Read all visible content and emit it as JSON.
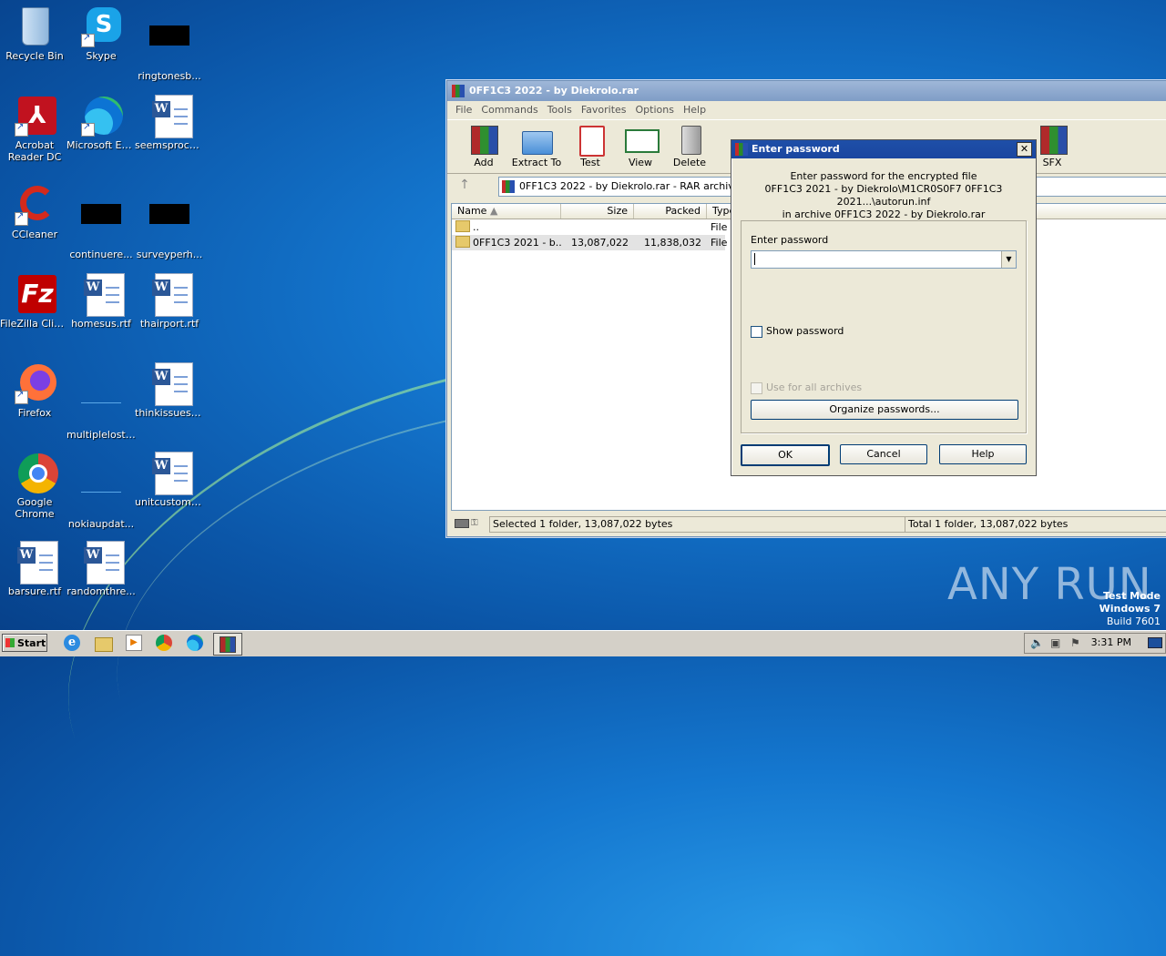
{
  "desktop": {
    "icons": [
      {
        "label": "Recycle Bin"
      },
      {
        "label": "Skype"
      },
      {
        "label": "ringtonesb..."
      },
      {
        "label": "Acrobat Reader DC"
      },
      {
        "label": "Microsoft Edge"
      },
      {
        "label": "seemsproce..."
      },
      {
        "label": "CCleaner"
      },
      {
        "label": "continuere..."
      },
      {
        "label": "surveyperh..."
      },
      {
        "label": "FileZilla Client"
      },
      {
        "label": "homesus.rtf"
      },
      {
        "label": "thairport.rtf"
      },
      {
        "label": "Firefox"
      },
      {
        "label": "multiplelost...."
      },
      {
        "label": "thinkissues.rtf"
      },
      {
        "label": "Google Chrome"
      },
      {
        "label": "nokiaupdat..."
      },
      {
        "label": "unitcustome..."
      },
      {
        "label": "barsure.rtf"
      },
      {
        "label": "randomthre..."
      }
    ]
  },
  "winrar": {
    "title": "0FF1C3 2022 - by Diekrolo.rar",
    "menu": [
      "File",
      "Commands",
      "Tools",
      "Favorites",
      "Options",
      "Help"
    ],
    "toolbar": [
      "Add",
      "Extract To",
      "Test",
      "View",
      "Delete",
      "SFX"
    ],
    "path": "0FF1C3 2022 - by Diekrolo.rar - RAR archive, ur",
    "columns": {
      "name": "Name",
      "size": "Size",
      "packed": "Packed",
      "type": "Type"
    },
    "rows": [
      {
        "name": "..",
        "size": "",
        "packed": "",
        "type": "File f"
      },
      {
        "name": "0FF1C3 2021 - b...",
        "size": "13,087,022",
        "packed": "11,838,032",
        "type": "File f"
      }
    ],
    "status_left": "Selected 1 folder, 13,087,022 bytes",
    "status_right": "Total 1 folder, 13,087,022 bytes"
  },
  "dialog": {
    "title": "Enter password",
    "info_line1": "Enter password for the encrypted file",
    "info_line2": "0FF1C3 2021 - by Diekrolo\\M1CR0S0F7 0FF1C3 2021...\\autorun.inf",
    "info_line3": "in archive 0FF1C3 2022 - by Diekrolo.rar",
    "field_label": "Enter password",
    "field_value": "",
    "show_password": "Show password",
    "use_for_all": "Use for all archives",
    "organize": "Organize passwords...",
    "ok": "OK",
    "cancel": "Cancel",
    "help": "Help"
  },
  "taskbar": {
    "start": "Start",
    "clock": "3:31 PM"
  },
  "watermark": {
    "brand": "ANY RUN",
    "line1": "Test Mode",
    "line2": "Windows 7",
    "line3": "Build 7601"
  }
}
